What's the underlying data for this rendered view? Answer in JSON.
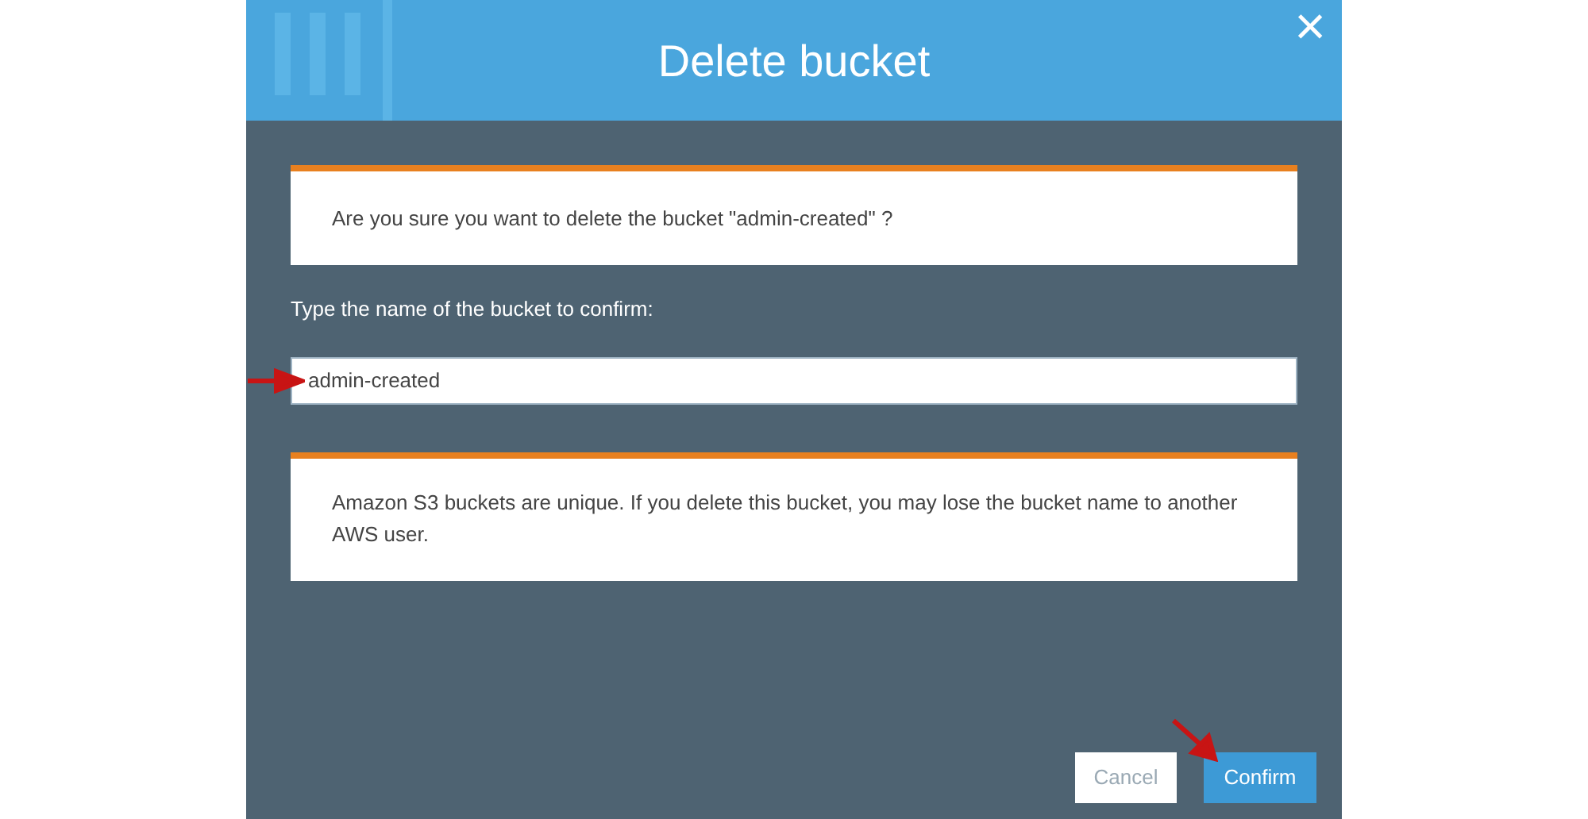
{
  "dialog": {
    "title": "Delete bucket",
    "close": "×"
  },
  "question": "Are you sure you want to delete the bucket \"admin-created\" ?",
  "confirm_label": "Type the name of the bucket to confirm:",
  "bucket_name_field": {
    "value": "admin-created"
  },
  "notice": "Amazon S3 buckets are unique. If you delete this bucket, you may lose the bucket name to another AWS user.",
  "buttons": [
    {
      "label": "Cancel",
      "kind": "secondary"
    },
    {
      "label": "Confirm",
      "kind": "primary"
    }
  ]
}
